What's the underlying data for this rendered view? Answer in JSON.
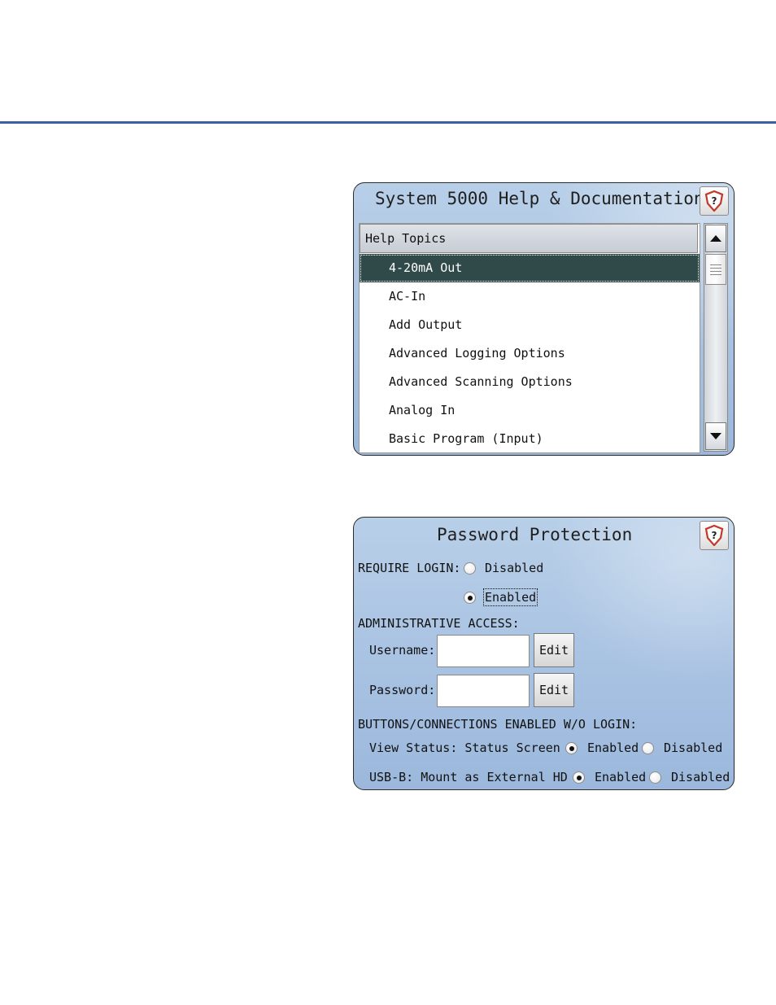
{
  "help_panel": {
    "title": "System 5000 Help & Documentation",
    "list_header": "Help Topics",
    "topics": [
      {
        "label": "4-20mA Out",
        "selected": true
      },
      {
        "label": "AC-In",
        "selected": false
      },
      {
        "label": "Add Output",
        "selected": false
      },
      {
        "label": "Advanced Logging Options",
        "selected": false
      },
      {
        "label": "Advanced Scanning Options",
        "selected": false
      },
      {
        "label": "Analog In",
        "selected": false
      },
      {
        "label": "Basic Program (Input)",
        "selected": false
      }
    ]
  },
  "password_panel": {
    "title": "Password Protection",
    "require_login_label": "REQUIRE LOGIN:",
    "require_login_options": {
      "disabled": "Disabled",
      "enabled": "Enabled"
    },
    "require_login_selected": "Enabled",
    "admin_access_label": "ADMINISTRATIVE ACCESS:",
    "username_label": "Username:",
    "username_value": "",
    "password_label": "Password:",
    "password_value": "",
    "edit_label": "Edit",
    "buttons_connections_label": "BUTTONS/CONNECTIONS ENABLED W/O LOGIN:",
    "view_status_label": "View Status: Status Screen",
    "view_status_options": {
      "enabled": "Enabled",
      "disabled": "Disabled"
    },
    "view_status_selected": "Enabled",
    "usb_label": "USB-B: Mount as External HD",
    "usb_options": {
      "enabled": "Enabled",
      "disabled": "Disabled"
    },
    "usb_selected": "Enabled"
  },
  "colors": {
    "top_rule": "#3a5fa3",
    "panel_bg": "#a8c2e2",
    "selected_row": "#2f4a48",
    "help_icon_red": "#c0392b"
  },
  "icons": {
    "help": "help-question-shield-icon",
    "scroll_up": "triangle-up-icon",
    "scroll_down": "triangle-down-icon"
  }
}
